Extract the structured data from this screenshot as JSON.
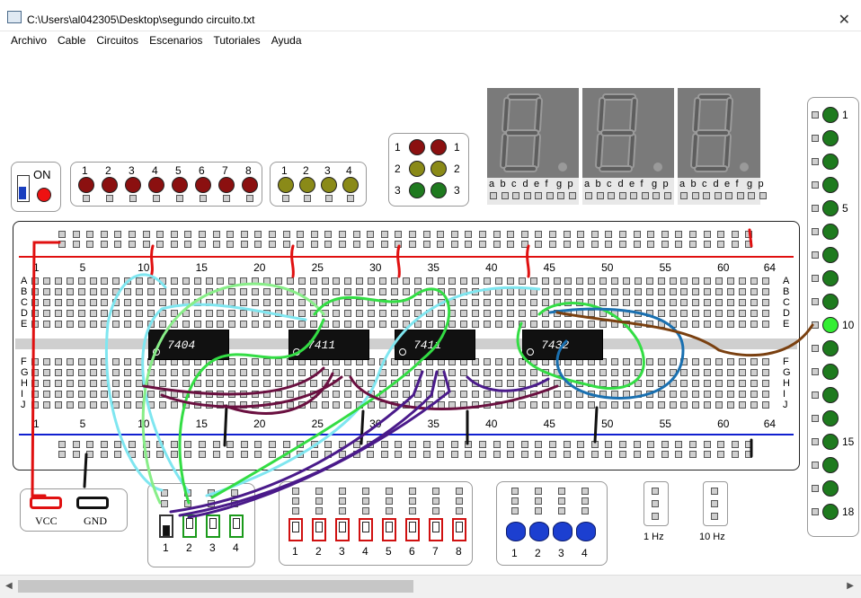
{
  "window": {
    "title": "C:\\Users\\al042305\\Desktop\\segundo circuito.txt",
    "close": "✕"
  },
  "menu": [
    "Archivo",
    "Cable",
    "Circuitos",
    "Escenarios",
    "Tutoriales",
    "Ayuda"
  ],
  "power": {
    "label": "ON"
  },
  "led_bank_red": {
    "labels": [
      "1",
      "2",
      "3",
      "4",
      "5",
      "6",
      "7",
      "8"
    ],
    "color": "#8b1010"
  },
  "led_bank_olive": {
    "labels": [
      "1",
      "2",
      "3",
      "4"
    ],
    "color": "#8a8a18"
  },
  "traffic": {
    "left": [
      "1",
      "2",
      "3"
    ],
    "right": [
      "1",
      "2",
      "3"
    ],
    "colors": [
      "#8b1010",
      "#8a8a18",
      "#1f7a1f"
    ]
  },
  "seven_seg": {
    "labels": [
      "a",
      "b",
      "c",
      "d",
      "e",
      "f",
      "g",
      "p"
    ],
    "digits": 3
  },
  "breadboard": {
    "col_numbers": [
      "1",
      "5",
      "10",
      "15",
      "20",
      "25",
      "30",
      "35",
      "40",
      "45",
      "50",
      "55",
      "60",
      "64"
    ],
    "rows_top": [
      "A",
      "B",
      "C",
      "D",
      "E"
    ],
    "rows_bottom": [
      "F",
      "G",
      "H",
      "I",
      "J"
    ]
  },
  "chips": [
    "7404",
    "7411",
    "7411",
    "7432"
  ],
  "supply": {
    "vcc": "VCC",
    "gnd": "GND"
  },
  "switches_green": {
    "labels": [
      "1",
      "2",
      "3",
      "4"
    ]
  },
  "switches_red": {
    "labels": [
      "1",
      "2",
      "3",
      "4",
      "5",
      "6",
      "7",
      "8"
    ]
  },
  "buttons": {
    "labels": [
      "1",
      "2",
      "3",
      "4"
    ],
    "color": "#1c3fd0"
  },
  "clocks": [
    "1 Hz",
    "10 Hz"
  ],
  "output_leds": {
    "labels": [
      "1",
      "5",
      "10",
      "15",
      "18"
    ],
    "lit_index": 9,
    "color": "#1e7a1e",
    "lit_color": "#33ee33"
  },
  "wire_colors": {
    "cyan": "#7fe6f0",
    "green": "#33dd44",
    "lightgreen": "#88ee88",
    "purple": "#4a1a8a",
    "maroon": "#6a1040",
    "blue": "#1a70b0",
    "brown": "#7a4010",
    "red": "#e01010",
    "black": "#111111"
  }
}
